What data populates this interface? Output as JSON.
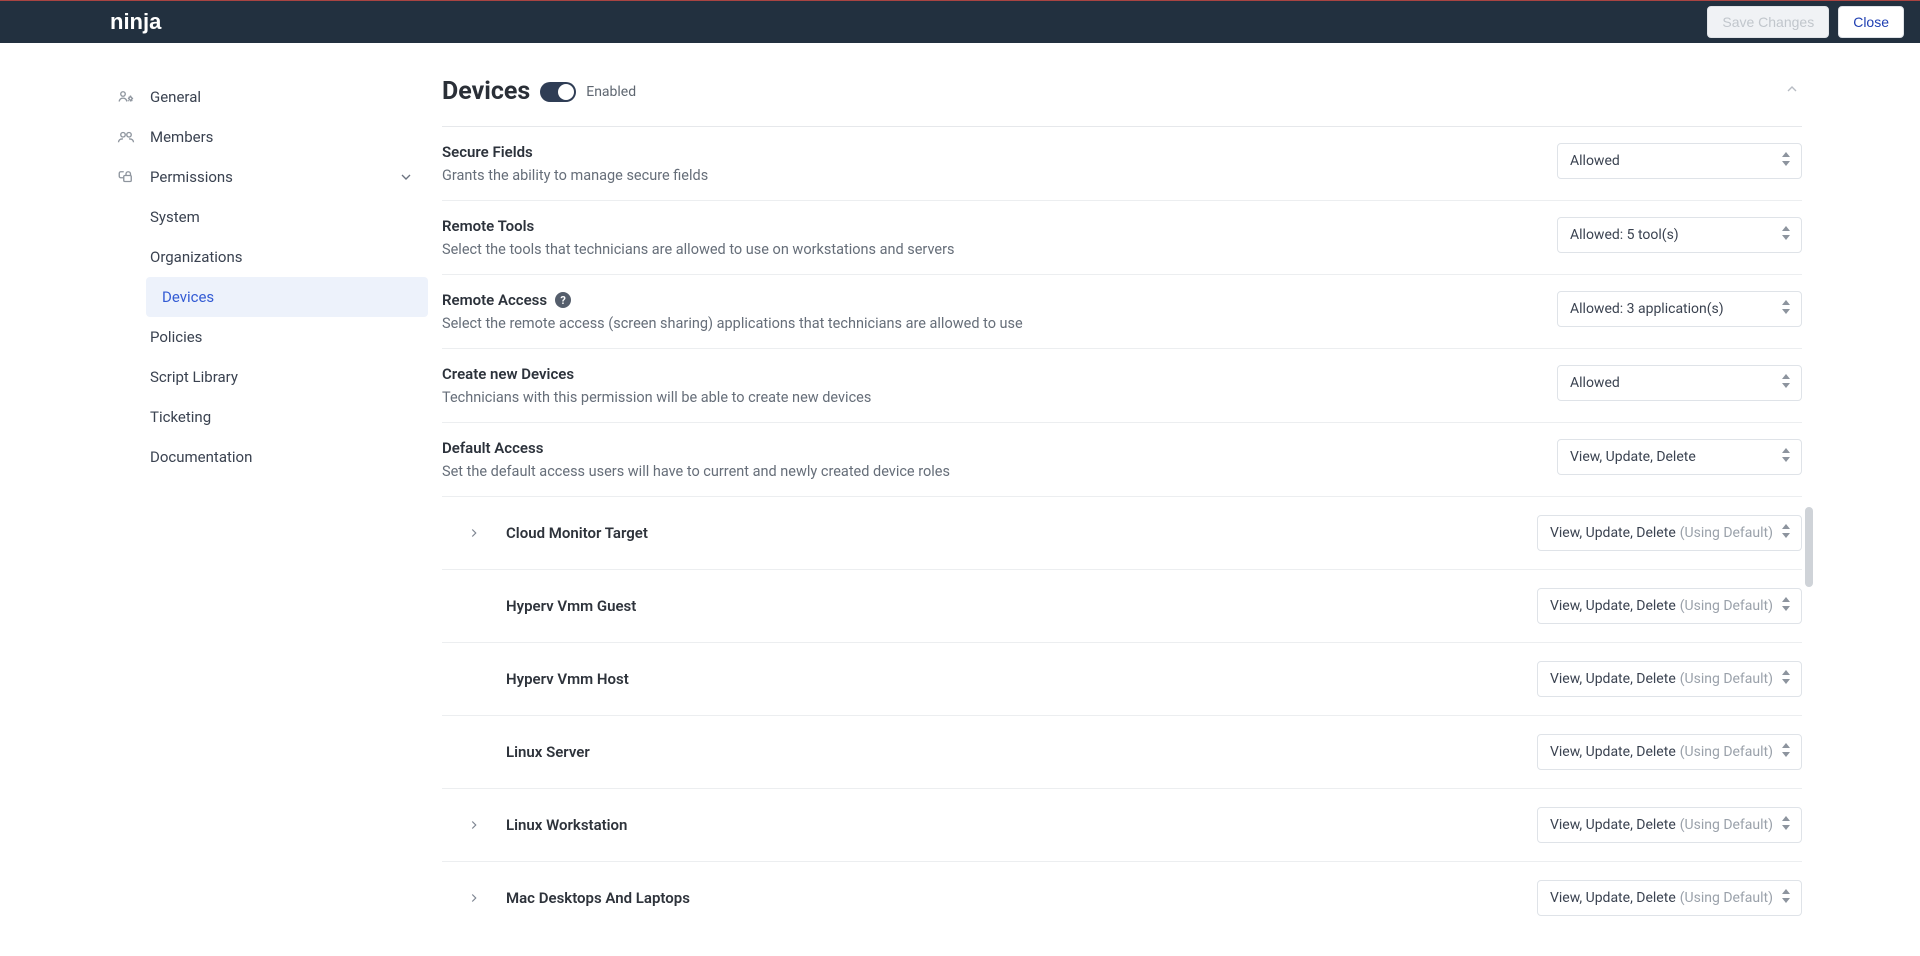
{
  "header": {
    "logo_text": "ninja",
    "save_label": "Save Changes",
    "close_label": "Close"
  },
  "sidebar": {
    "items": [
      {
        "label": "General"
      },
      {
        "label": "Members"
      },
      {
        "label": "Permissions"
      }
    ],
    "permissions_children": [
      {
        "label": "System"
      },
      {
        "label": "Organizations"
      },
      {
        "label": "Devices",
        "active": true
      },
      {
        "label": "Policies"
      },
      {
        "label": "Script Library"
      },
      {
        "label": "Ticketing"
      },
      {
        "label": "Documentation"
      }
    ]
  },
  "page": {
    "title": "Devices",
    "toggle_label": "Enabled"
  },
  "settings": [
    {
      "title": "Secure Fields",
      "desc": "Grants the ability to manage secure fields",
      "value": "Allowed"
    },
    {
      "title": "Remote Tools",
      "desc": "Select the tools that technicians are allowed to use on workstations and servers",
      "value": "Allowed: 5 tool(s)"
    },
    {
      "title": "Remote Access",
      "help": true,
      "desc": "Select the remote access (screen sharing) applications that technicians are allowed to use",
      "value": "Allowed: 3 application(s)"
    },
    {
      "title": "Create new Devices",
      "desc": "Technicians with this permission will be able to create new devices",
      "value": "Allowed"
    },
    {
      "title": "Default Access",
      "desc": "Set the default access users will have to current and newly created device roles",
      "value": "View, Update, Delete"
    }
  ],
  "roles": [
    {
      "name": "Cloud Monitor Target",
      "has_chevron": true,
      "value": "View, Update, Delete",
      "suffix": "(Using Default)"
    },
    {
      "name": "Hyperv Vmm Guest",
      "has_chevron": false,
      "value": "View, Update, Delete",
      "suffix": "(Using Default)"
    },
    {
      "name": "Hyperv Vmm Host",
      "has_chevron": false,
      "value": "View, Update, Delete",
      "suffix": "(Using Default)"
    },
    {
      "name": "Linux Server",
      "has_chevron": false,
      "value": "View, Update, Delete",
      "suffix": "(Using Default)"
    },
    {
      "name": "Linux Workstation",
      "has_chevron": true,
      "value": "View, Update, Delete",
      "suffix": "(Using Default)"
    },
    {
      "name": "Mac Desktops And Laptops",
      "has_chevron": true,
      "value": "View, Update, Delete",
      "suffix": "(Using Default)"
    }
  ]
}
